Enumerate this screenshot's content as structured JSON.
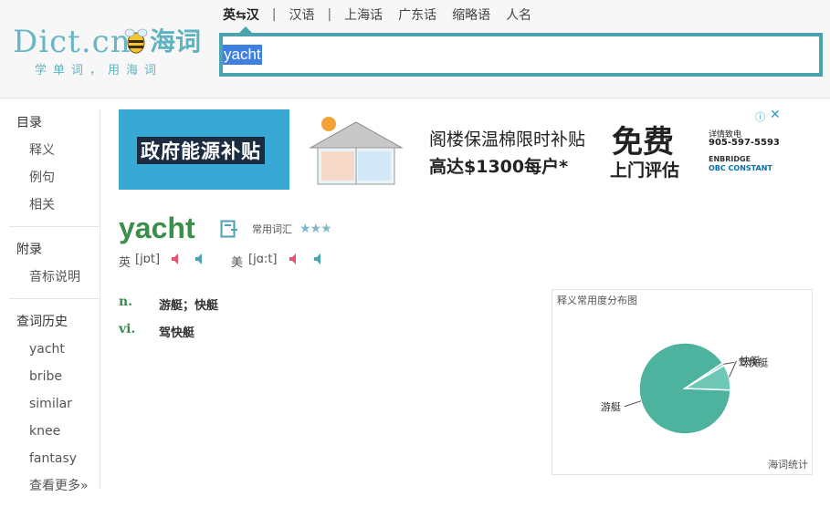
{
  "header": {
    "logo_text": "Dict.cn",
    "logo_cn": "海词",
    "slogan": "学单词，用海词",
    "tabs": [
      {
        "label": "英⇆汉",
        "active": true
      },
      {
        "label": "汉语",
        "active": false
      },
      {
        "label": "上海话",
        "active": false
      },
      {
        "label": "广东话",
        "active": false
      },
      {
        "label": "缩略语",
        "active": false
      },
      {
        "label": "人名",
        "active": false
      }
    ],
    "search_value": "yacht",
    "accent_color": "#4aa3ad"
  },
  "sidebar": {
    "groups": [
      {
        "title": "目录",
        "items": [
          "释义",
          "例句",
          "相关"
        ]
      },
      {
        "title": "附录",
        "items": [
          "音标说明"
        ]
      },
      {
        "title": "查词历史",
        "items": [
          "yacht",
          "bribe",
          "similar",
          "knee",
          "fantasy",
          "查看更多»"
        ]
      }
    ]
  },
  "ad": {
    "left_text": "政府能源补贴",
    "line1": "阁楼保温棉限时补贴",
    "line2": "高达$1300每户*",
    "free": "免费",
    "visit": "上门评估",
    "info1": "详情致电",
    "info2": "905-597-5593",
    "brand1": "ENBRIDGE",
    "brand2": "OBC CONSTANT",
    "choice_icon": "ⓘ",
    "close_icon": "✕"
  },
  "word": {
    "title": "yacht",
    "level": "常用词汇",
    "stars": "★★★",
    "pron_uk_label": "英",
    "pron_uk": "[jɒt]",
    "pron_us_label": "美",
    "pron_us": "[jɑ:t]"
  },
  "definitions": [
    {
      "pos": "n.",
      "text": "游艇；快艇"
    },
    {
      "pos": "vi.",
      "text": "驾快艇"
    }
  ],
  "chart": {
    "title": "释义常用度分布图",
    "footer": "海词统计"
  },
  "chart_data": {
    "type": "pie",
    "title": "释义常用度分布图",
    "categories": [
      "游艇",
      "快艇",
      "驾快艇"
    ],
    "values": [
      90,
      9,
      1
    ],
    "colors": [
      "#4db39e",
      "#6fc7b6",
      "#9ed7cb"
    ]
  }
}
